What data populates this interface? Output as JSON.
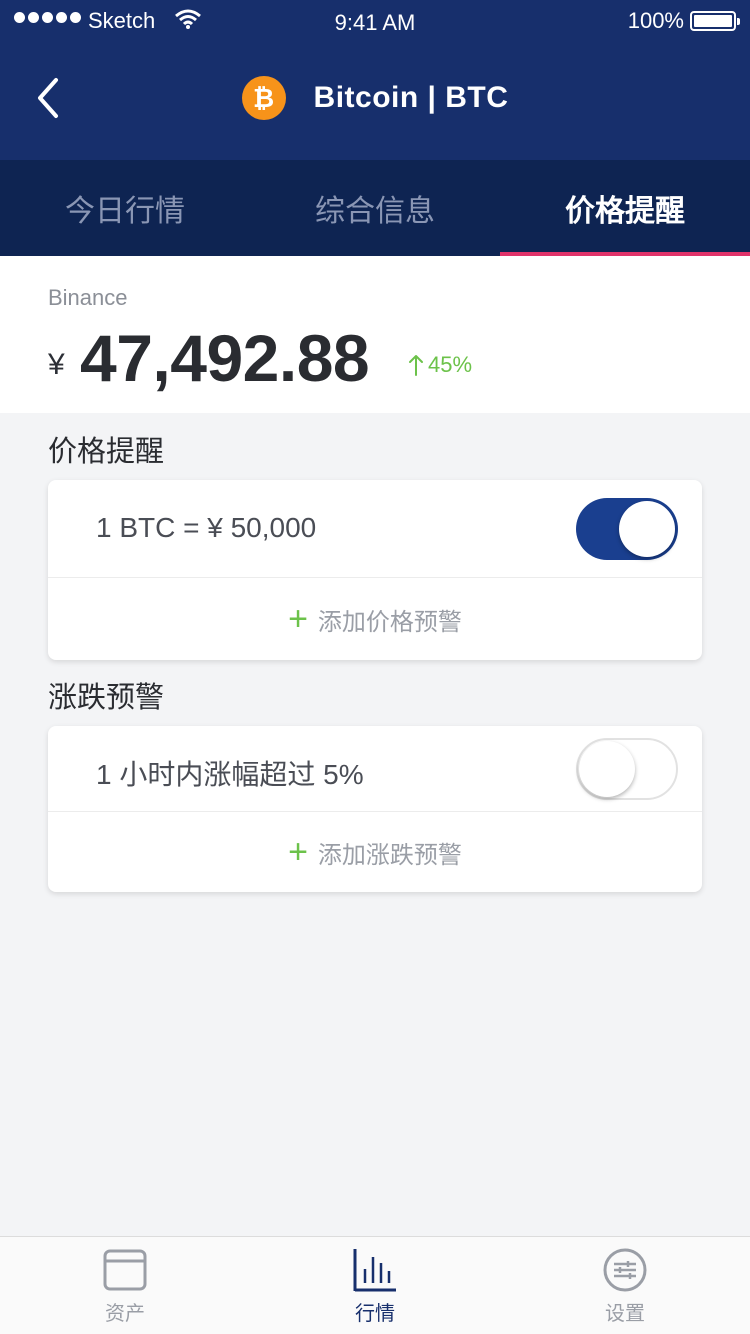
{
  "status_bar": {
    "carrier": "Sketch",
    "time": "9:41 AM",
    "battery": "100%"
  },
  "nav": {
    "coin_symbol_glyph": "₿",
    "title": "Bitcoin | BTC",
    "coin_color": "#f7931a"
  },
  "tabs": [
    {
      "label": "今日行情",
      "active": false
    },
    {
      "label": "综合信息",
      "active": false
    },
    {
      "label": "价格提醒",
      "active": true
    }
  ],
  "price": {
    "exchange": "Binance",
    "currency": "¥",
    "value": "47,492.88",
    "change": "45%",
    "change_direction": "up",
    "change_color": "#6cc24a"
  },
  "price_alerts": {
    "section_title": "价格提醒",
    "items": [
      {
        "text": "1 BTC = ¥ 50,000",
        "enabled": true
      }
    ],
    "add_label": "添加价格预警"
  },
  "change_alerts": {
    "section_title": "涨跌预警",
    "items": [
      {
        "text": "1 小时内涨幅超过 5%",
        "enabled": false
      }
    ],
    "add_label": "添加涨跌预警"
  },
  "tabbar": [
    {
      "label": "资产",
      "icon": "wallet-icon",
      "active": false
    },
    {
      "label": "行情",
      "icon": "market-chart-icon",
      "active": true
    },
    {
      "label": "设置",
      "icon": "settings-sliders-icon",
      "active": false
    }
  ],
  "colors": {
    "header": "#172f6c",
    "tab_bar_bg": "#0e2452",
    "tab_indicator": "#e0336a",
    "toggle_on": "#1a3f8f"
  }
}
